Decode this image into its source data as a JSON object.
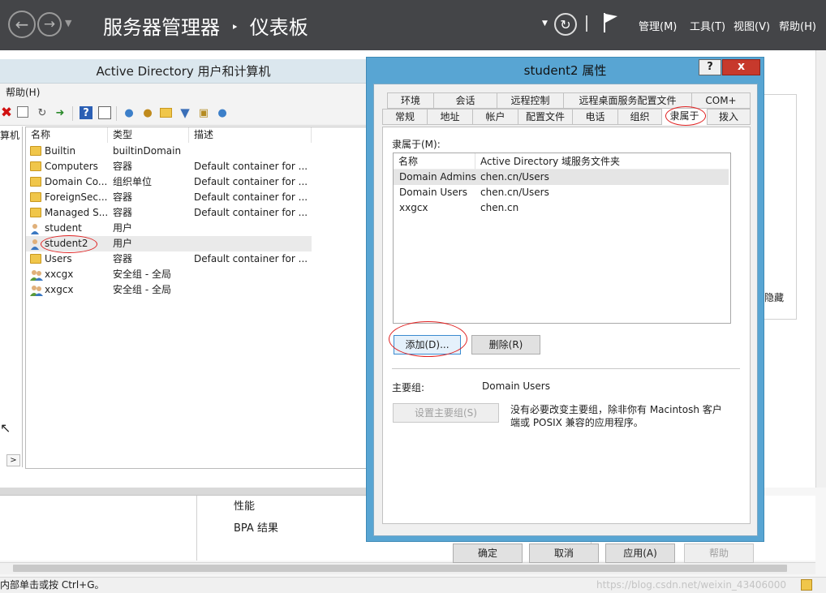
{
  "server_manager": {
    "title_part1": "服务器管理器",
    "title_sep": "‣",
    "title_part2": "仪表板",
    "menus": [
      "管理(M)",
      "工具(T)",
      "视图(V)",
      "帮助(H)"
    ],
    "hidden_text": "隐藏",
    "bottom_items": [
      "性能",
      "BPA 结果"
    ],
    "status_text": "内部单击或按 Ctrl+G。",
    "watermark": "https://blog.csdn.net/weixin_43406000"
  },
  "aduc": {
    "title": "Active Directory 用户和计算机",
    "menu_help": "帮助(H)",
    "tree_label": "算机",
    "columns": [
      "名称",
      "类型",
      "描述"
    ],
    "rows": [
      {
        "name": "Builtin",
        "type": "builtinDomain",
        "desc": "",
        "icon": "folder-icon"
      },
      {
        "name": "Computers",
        "type": "容器",
        "desc": "Default container for ...",
        "icon": "folder-icon"
      },
      {
        "name": "Domain Co...",
        "type": "组织单位",
        "desc": "Default container for ...",
        "icon": "folder-icon"
      },
      {
        "name": "ForeignSec...",
        "type": "容器",
        "desc": "Default container for ...",
        "icon": "folder-icon"
      },
      {
        "name": "Managed S...",
        "type": "容器",
        "desc": "Default container for ...",
        "icon": "folder-icon"
      },
      {
        "name": "student",
        "type": "用户",
        "desc": "",
        "icon": "user-icon"
      },
      {
        "name": "student2",
        "type": "用户",
        "desc": "",
        "icon": "user-icon"
      },
      {
        "name": "Users",
        "type": "容器",
        "desc": "Default container for ...",
        "icon": "folder-icon"
      },
      {
        "name": "xxcgx",
        "type": "安全组 - 全局",
        "desc": "",
        "icon": "group-icon"
      },
      {
        "name": "xxgcx",
        "type": "安全组 - 全局",
        "desc": "",
        "icon": "group-icon"
      }
    ]
  },
  "dialog": {
    "title": "student2 属性",
    "help_btn": "?",
    "close_btn": "x",
    "tabs_row1": [
      "环境",
      "会话",
      "远程控制",
      "远程桌面服务配置文件",
      "COM+"
    ],
    "tabs_row2": [
      "常规",
      "地址",
      "帐户",
      "配置文件",
      "电话",
      "组织",
      "隶属于",
      "拨入"
    ],
    "active_tab": "隶属于",
    "member_of_label": "隶属于(M):",
    "member_columns": [
      "名称",
      "Active Directory 域服务文件夹"
    ],
    "members": [
      {
        "name": "Domain Admins",
        "folder": "chen.cn/Users"
      },
      {
        "name": "Domain Users",
        "folder": "chen.cn/Users"
      },
      {
        "name": "xxgcx",
        "folder": "chen.cn"
      }
    ],
    "add_btn": "添加(D)...",
    "remove_btn": "删除(R)",
    "primary_group_label": "主要组:",
    "primary_group_value": "Domain Users",
    "set_primary_btn": "设置主要组(S)",
    "primary_note_line1": "没有必要改变主要组，除非你有 Macintosh 客户",
    "primary_note_line2": "端或 POSIX 兼容的应用程序。",
    "ok_btn": "确定",
    "cancel_btn": "取消",
    "apply_btn": "应用(A)",
    "help_footer_btn": "帮助"
  },
  "colors": {
    "header_bg": "#444548",
    "dialog_frame": "#58a5d3",
    "annotation_red": "#e02020"
  }
}
